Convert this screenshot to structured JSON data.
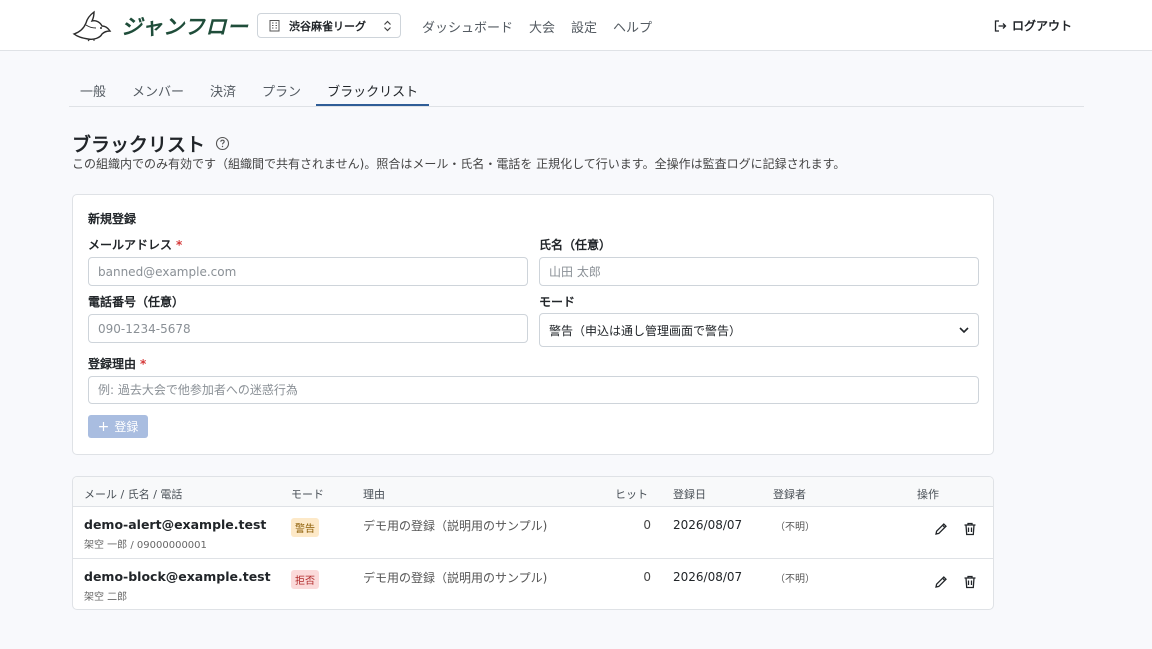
{
  "header": {
    "logo_text": "ジャンフロー",
    "org": "渋谷麻雀リーグ",
    "nav": [
      "ダッシュボード",
      "大会",
      "設定",
      "ヘルプ"
    ],
    "logout": "ログアウト"
  },
  "tabs": [
    "一般",
    "メンバー",
    "決済",
    "プラン",
    "ブラックリスト"
  ],
  "page": {
    "title": "ブラックリスト",
    "description": "この組織内でのみ有効です（組織間で共有されません)。照合はメール・氏名・電話を 正規化して行います。全操作は監査ログに記録されます。"
  },
  "form": {
    "title": "新規登録",
    "email_label": "メールアドレス",
    "email_placeholder": "banned@example.com",
    "name_label": "氏名（任意）",
    "name_placeholder": "山田 太郎",
    "phone_label": "電話番号（任意）",
    "phone_placeholder": "090-1234-5678",
    "mode_label": "モード",
    "mode_value": "警告（申込は通し管理画面で警告）",
    "reason_label": "登録理由",
    "reason_placeholder": "例: 過去大会で他参加者への迷惑行為",
    "required_mark": "*",
    "submit": "登録"
  },
  "table": {
    "headers": {
      "contact": "メール / 氏名 / 電話",
      "mode": "モード",
      "reason": "理由",
      "hits": "ヒット",
      "date": "登録日",
      "by": "登録者",
      "actions": "操作"
    },
    "rows": [
      {
        "email": "demo-alert@example.test",
        "sub": "架空 一郎 / 09000000001",
        "mode": "警告",
        "reason": "デモ用の登録（説明用のサンプル)",
        "hits": "0",
        "date": "2026/08/07",
        "by": "（不明）"
      },
      {
        "email": "demo-block@example.test",
        "sub": "架空 二郎",
        "mode": "拒否",
        "reason": "デモ用の登録（説明用のサンプル)",
        "hits": "0",
        "date": "2026/08/07",
        "by": "（不明）"
      }
    ]
  },
  "colors": {
    "brand": "#1f4d3a",
    "tab_active": "#2f5d97",
    "submit_disabled": "#a9bde0",
    "badge_warn_bg": "#fde9c8",
    "badge_block_bg": "#fbdada"
  }
}
